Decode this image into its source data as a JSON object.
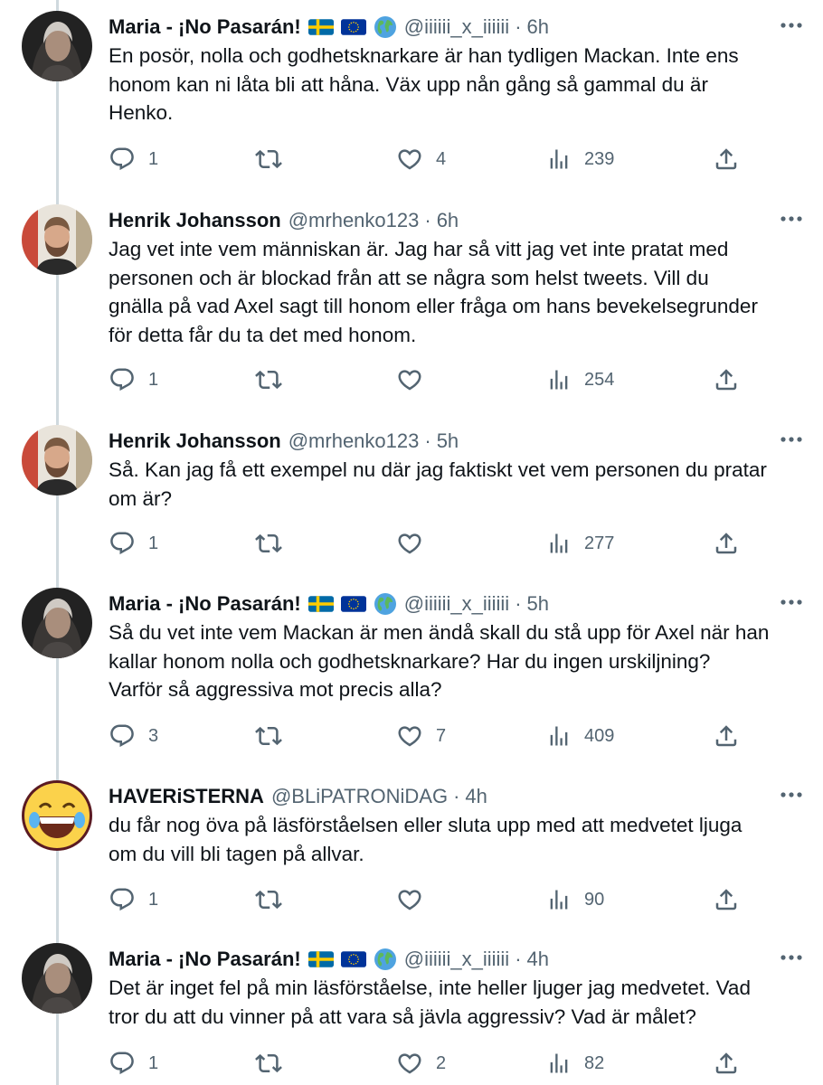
{
  "tweets": [
    {
      "avatar": "maria-avatar",
      "name": "Maria - ¡No Pasarán!",
      "flags": [
        "swedish-flag-icon",
        "eu-flag-icon",
        "globe-icon"
      ],
      "handle": "@iiiiii_x_iiiiii",
      "time": "6h",
      "text": "En posör, nolla och godhetsknarkare är han tydligen Mackan. Inte ens\nhonom kan ni låta bli att håna. Väx upp nån gång så gammal du är\nHenko.",
      "replies": "1",
      "retweets": "",
      "likes": "4",
      "views": "239"
    },
    {
      "avatar": "henrik-avatar",
      "name": "Henrik Johansson",
      "flags": [],
      "handle": "@mrhenko123",
      "time": "6h",
      "text": "Jag vet inte vem människan är. Jag har så vitt jag vet inte pratat med\npersonen och är blockad från att se några som helst tweets. Vill du\ngnälla på vad Axel sagt till honom eller fråga om hans bevekelsegrunder\nför detta får du ta det med honom.",
      "replies": "1",
      "retweets": "",
      "likes": "",
      "views": "254"
    },
    {
      "avatar": "henrik-avatar",
      "name": "Henrik Johansson",
      "flags": [],
      "handle": "@mrhenko123",
      "time": "5h",
      "text": "Så. Kan jag få ett exempel nu där jag faktiskt vet vem personen du pratar\nom är?",
      "replies": "1",
      "retweets": "",
      "likes": "",
      "views": "277"
    },
    {
      "avatar": "maria-avatar",
      "name": "Maria - ¡No Pasarán!",
      "flags": [
        "swedish-flag-icon",
        "eu-flag-icon",
        "globe-icon"
      ],
      "handle": "@iiiiii_x_iiiiii",
      "time": "5h",
      "text": "Så du vet inte vem Mackan är men ändå skall du stå upp för Axel när han\nkallar honom nolla och godhetsknarkare? Har du ingen urskiljning?\nVarför så aggressiva mot precis alla?",
      "replies": "3",
      "retweets": "",
      "likes": "7",
      "views": "409"
    },
    {
      "avatar": "laughing-emoji-avatar",
      "name": "HAVERiSTERNA",
      "flags": [],
      "handle": "@BLiPATRONiDAG",
      "time": "4h",
      "text": "du får nog öva på läsförståelsen eller sluta upp med att medvetet ljuga\nom du vill bli tagen på allvar.",
      "replies": "1",
      "retweets": "",
      "likes": "",
      "views": "90"
    },
    {
      "avatar": "maria-avatar",
      "name": "Maria - ¡No Pasarán!",
      "flags": [
        "swedish-flag-icon",
        "eu-flag-icon",
        "globe-icon"
      ],
      "handle": "@iiiiii_x_iiiiii",
      "time": "4h",
      "text": "Det är inget fel på min läsförståelse, inte heller ljuger jag medvetet. Vad\ntror du att du vinner på att vara så jävla aggressiv? Vad är målet?",
      "replies": "1",
      "retweets": "",
      "likes": "2",
      "views": "82"
    }
  ],
  "colors": {
    "text": "#0f1419",
    "secondary": "#536471",
    "thread_line": "#cfd9de",
    "swedish_blue": "#006aa7",
    "swedish_yellow": "#fecc00",
    "eu_blue": "#003399"
  }
}
